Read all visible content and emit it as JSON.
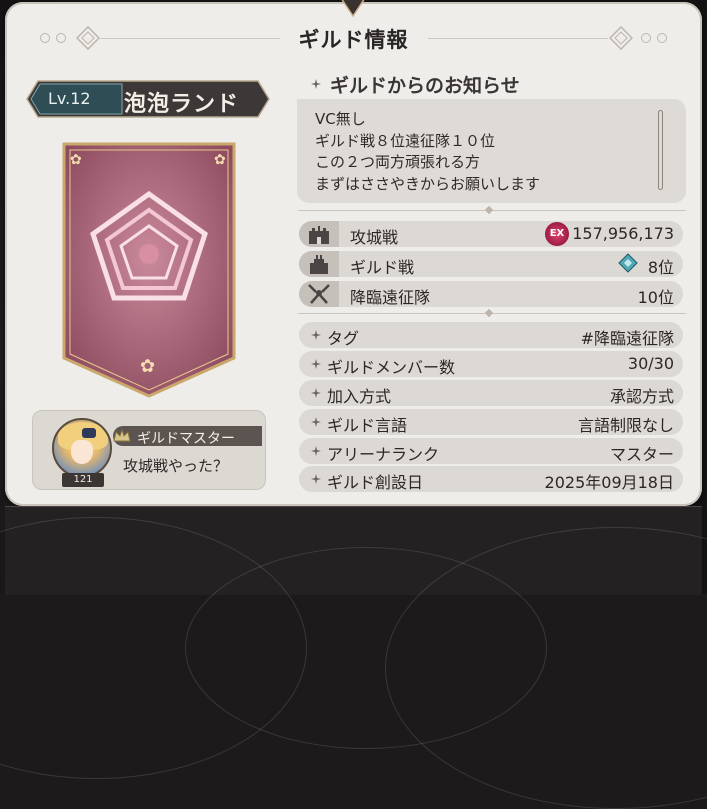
{
  "window": {
    "title": "ギルド情報"
  },
  "guild": {
    "level": "Lv.12",
    "name": "泡泡ランド"
  },
  "master": {
    "label": "ギルドマスター",
    "message": "攻城戦やった？",
    "level": "121"
  },
  "notice": {
    "heading": "ギルドからのお知らせ",
    "lines": [
      "VC無し",
      "ギルド戦８位遠征隊１０位",
      "この２つ両方頑張れる方",
      "まずはささやきからお願いします"
    ]
  },
  "stats": [
    {
      "label": "攻城戦",
      "value": "157,956,173",
      "icon": "castle-siege-icon"
    },
    {
      "label": "ギルド戦",
      "value": "8位",
      "icon": "guild-war-icon"
    },
    {
      "label": "降臨遠征隊",
      "value": "10位",
      "icon": "expedition-icon"
    }
  ],
  "details": [
    {
      "label": "タグ",
      "value": "#降臨遠征隊"
    },
    {
      "label": "ギルドメンバー数",
      "value": "30/30"
    },
    {
      "label": "加入方式",
      "value": "承認方式"
    },
    {
      "label": "ギルド言語",
      "value": "言語制限なし"
    },
    {
      "label": "アリーナランク",
      "value": "マスター"
    },
    {
      "label": "ギルド創設日",
      "value": "2025年09月18日"
    }
  ],
  "badges": {
    "ex": "EX"
  },
  "colors": {
    "banner": "#2f4d55",
    "emblem": "#b06a80",
    "panel": "#efedea"
  }
}
